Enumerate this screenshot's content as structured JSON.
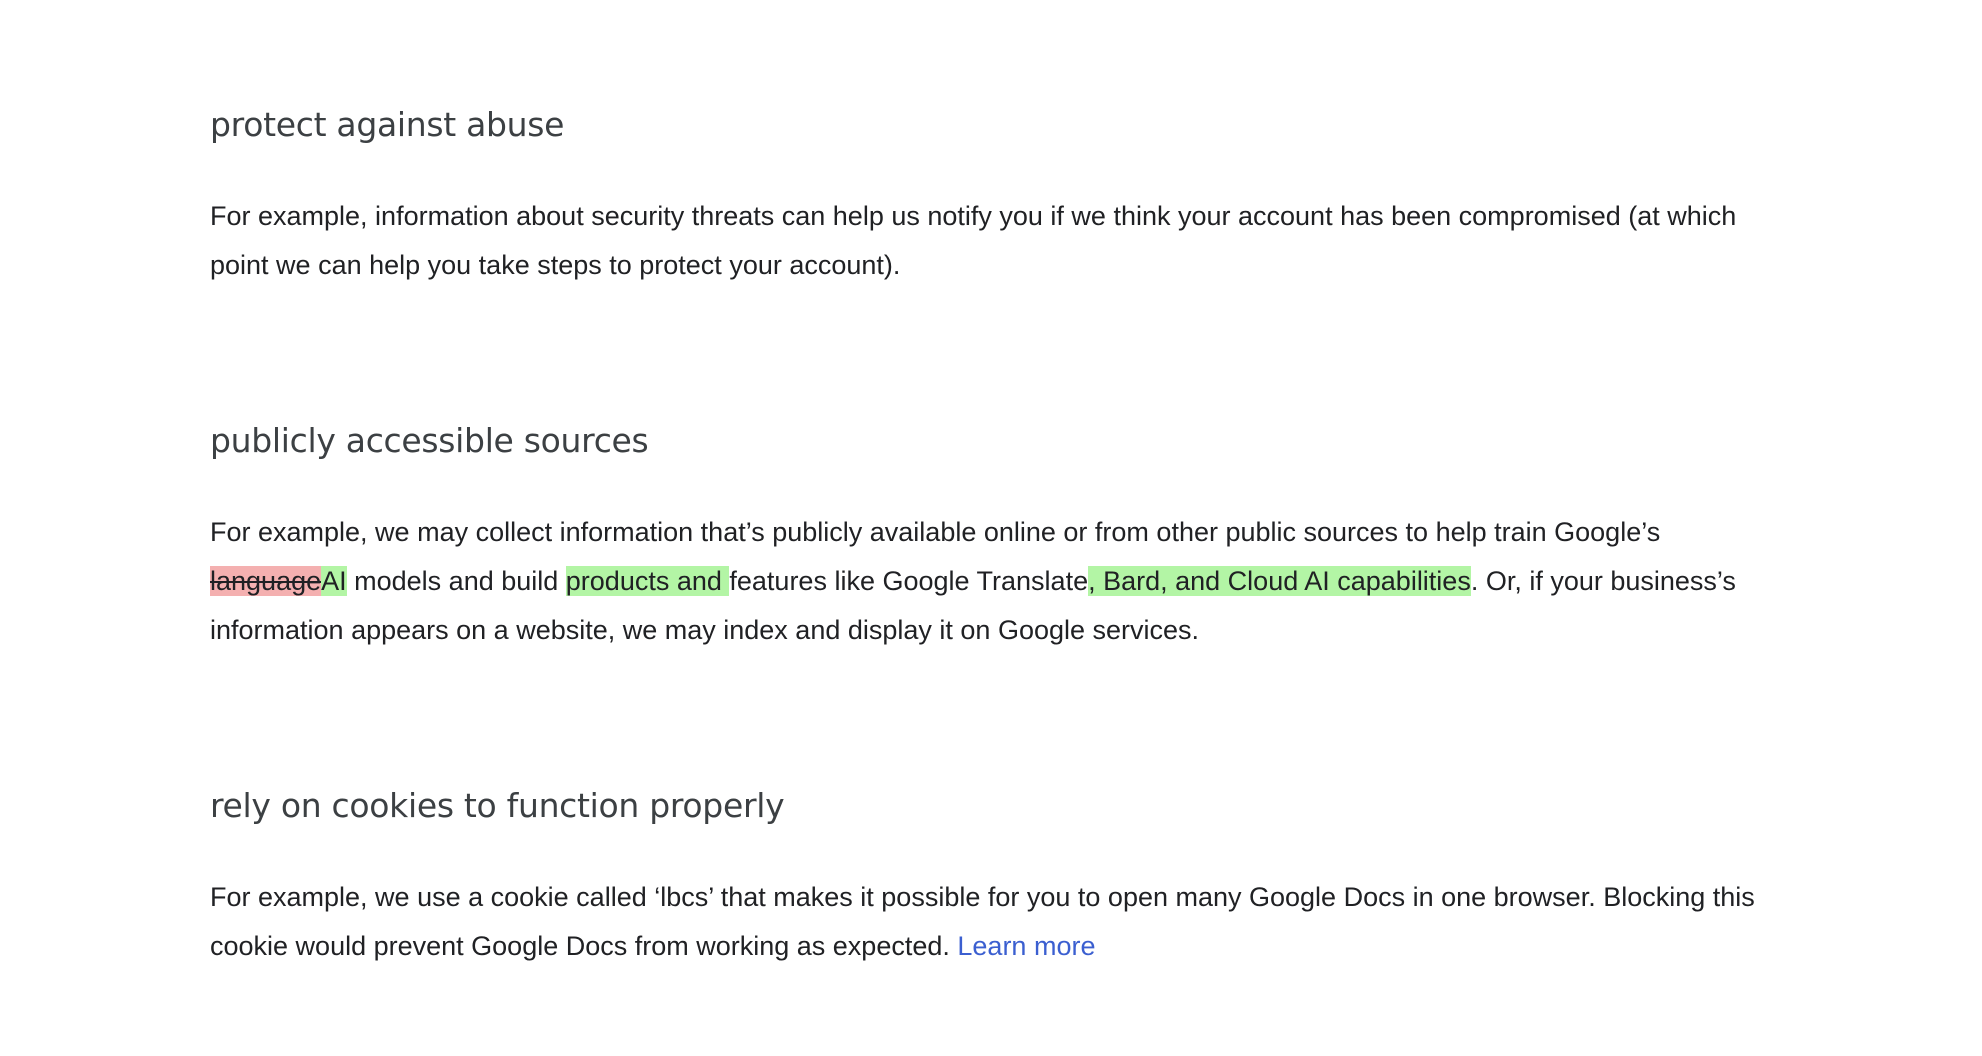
{
  "sections": [
    {
      "heading": "protect against abuse",
      "text": "For example, information about security threats can help us notify you if we think your account has been compromised (at which point we can help you take steps to protect your account)."
    },
    {
      "heading": "publicly accessible sources",
      "text_1": "For example, we may collect information that’s publicly available online or from other public sources to help train Google’s ",
      "deleted_1": "language",
      "inserted_1": "AI",
      "text_2": " models and build ",
      "inserted_2": "products and ",
      "text_3": "features like Google Translate",
      "inserted_3": ", Bard, and Cloud AI capabilities",
      "text_4": ". Or, if your business’s information appears on a website, we may index and display it on Google services."
    },
    {
      "heading": "rely on cookies to function properly",
      "text": "For example, we use a cookie called ‘lbcs’ that makes it possible for you to open many Google Docs in one browser. Blocking this cookie would prevent Google Docs from working as expected. ",
      "link": "Learn more"
    }
  ],
  "colors": {
    "deleted_highlight": "#f4b0b0",
    "inserted_highlight": "#b3f5a5",
    "link": "#3b5fd0",
    "heading": "#3c4043",
    "body_text": "#202124"
  }
}
